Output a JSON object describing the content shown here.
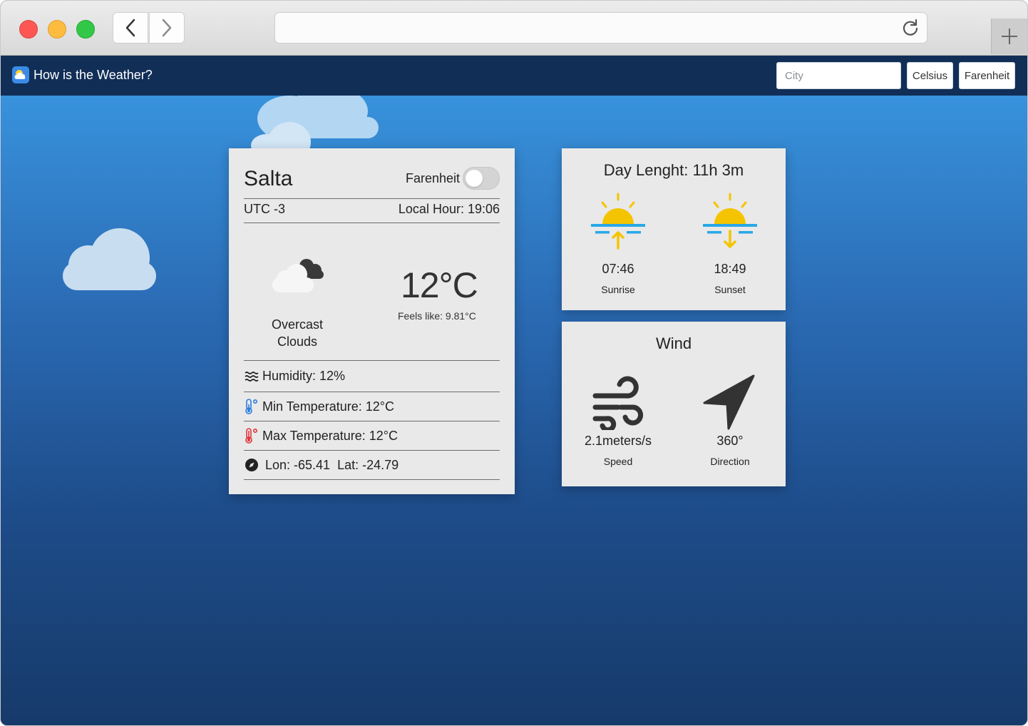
{
  "browser": {
    "url": ""
  },
  "navbar": {
    "brand": "How is the Weather?",
    "city_placeholder": "City",
    "celsius_label": "Celsius",
    "farenheit_label": "Farenheit"
  },
  "weather": {
    "city": "Salta",
    "toggle_label": "Farenheit",
    "utc": "UTC -3",
    "local_hour": "Local Hour: 19:06",
    "condition_line1": "Overcast",
    "condition_line2": "Clouds",
    "temperature": "12°C",
    "feels_like": "Feels like: 9.81°C",
    "humidity": "Humidity: 12%",
    "min_temp": "Min Temperature: 12°C",
    "max_temp": "Max Temperature: 12°C",
    "coords": "Lon: -65.41  Lat: -24.79"
  },
  "day": {
    "title": "Day Lenght: 11h 3m",
    "sunrise_time": "07:46",
    "sunrise_label": "Sunrise",
    "sunset_time": "18:49",
    "sunset_label": "Sunset"
  },
  "wind": {
    "title": "Wind",
    "speed": "2.1meters/s",
    "speed_label": "Speed",
    "direction": "360°",
    "direction_label": "Direction"
  },
  "colors": {
    "navbar": "#112e57",
    "card": "#e9e9e9",
    "sun": "#f5c400",
    "horizon": "#29a8e8"
  }
}
